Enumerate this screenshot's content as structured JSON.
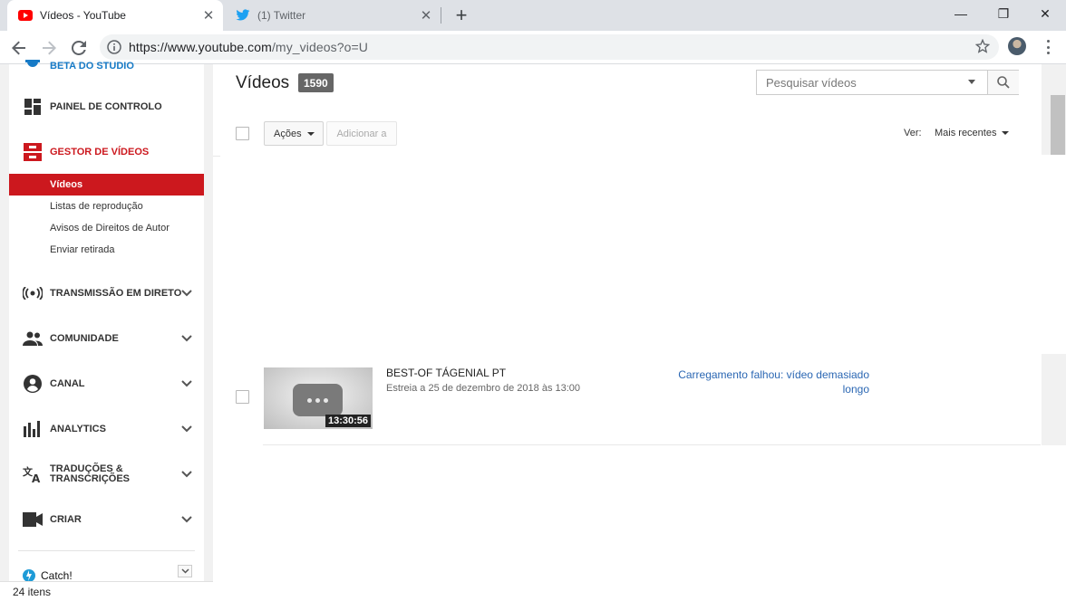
{
  "browser": {
    "tabs": [
      {
        "title": "Vídeos - YouTube",
        "active": true
      },
      {
        "title": "(1) Twitter",
        "active": false
      }
    ],
    "new_tab_label": "+",
    "url_base": "https://www.youtube.com",
    "url_rest": "/my_videos?o=U",
    "close_glyph": "✕",
    "minimize_glyph": "—",
    "maximize_glyph": "❐"
  },
  "sidebar": {
    "items": [
      {
        "label": "BETA DO STUDIO",
        "icon": "studio-gear-icon"
      },
      {
        "label": "PAINEL DE CONTROLO",
        "icon": "dashboard-icon"
      },
      {
        "label": "GESTOR DE VÍDEOS",
        "icon": "video-manager-icon"
      },
      {
        "label": "TRANSMISSÃO EM DIRETO",
        "icon": "live-stream-icon"
      },
      {
        "label": "COMUNIDADE",
        "icon": "community-icon"
      },
      {
        "label": "CANAL",
        "icon": "channel-icon"
      },
      {
        "label": "ANALYTICS",
        "icon": "analytics-icon"
      },
      {
        "label_line1": "TRADUÇÕES &",
        "label_line2": "TRANSCRIÇÕES",
        "icon": "translate-icon"
      },
      {
        "label": "CRIAR",
        "icon": "create-camera-icon"
      }
    ],
    "subitems": [
      "Vídeos",
      "Listas de reprodução",
      "Avisos de Direitos de Autor",
      "Enviar retirada"
    ],
    "catch_label": "Catch!",
    "status": "24 itens"
  },
  "main": {
    "heading": "Vídeos",
    "count": "1590",
    "search_placeholder": "Pesquisar vídeos",
    "actions_label": "Ações",
    "add_to_label": "Adicionar a",
    "view_label": "Ver:",
    "sort_value": "Mais recentes",
    "video": {
      "title": "BEST-OF TÁGENIAL PT",
      "subtitle": "Estreia a 25 de dezembro de 2018 às 13:00",
      "duration": "13:30:56",
      "status": "Carregamento falhou: vídeo demasiado longo"
    }
  },
  "colors": {
    "youtube_red": "#cc181e",
    "link_blue": "#2b67b3",
    "studio_blue": "#167ac6",
    "twitter_blue": "#1da1f2"
  }
}
